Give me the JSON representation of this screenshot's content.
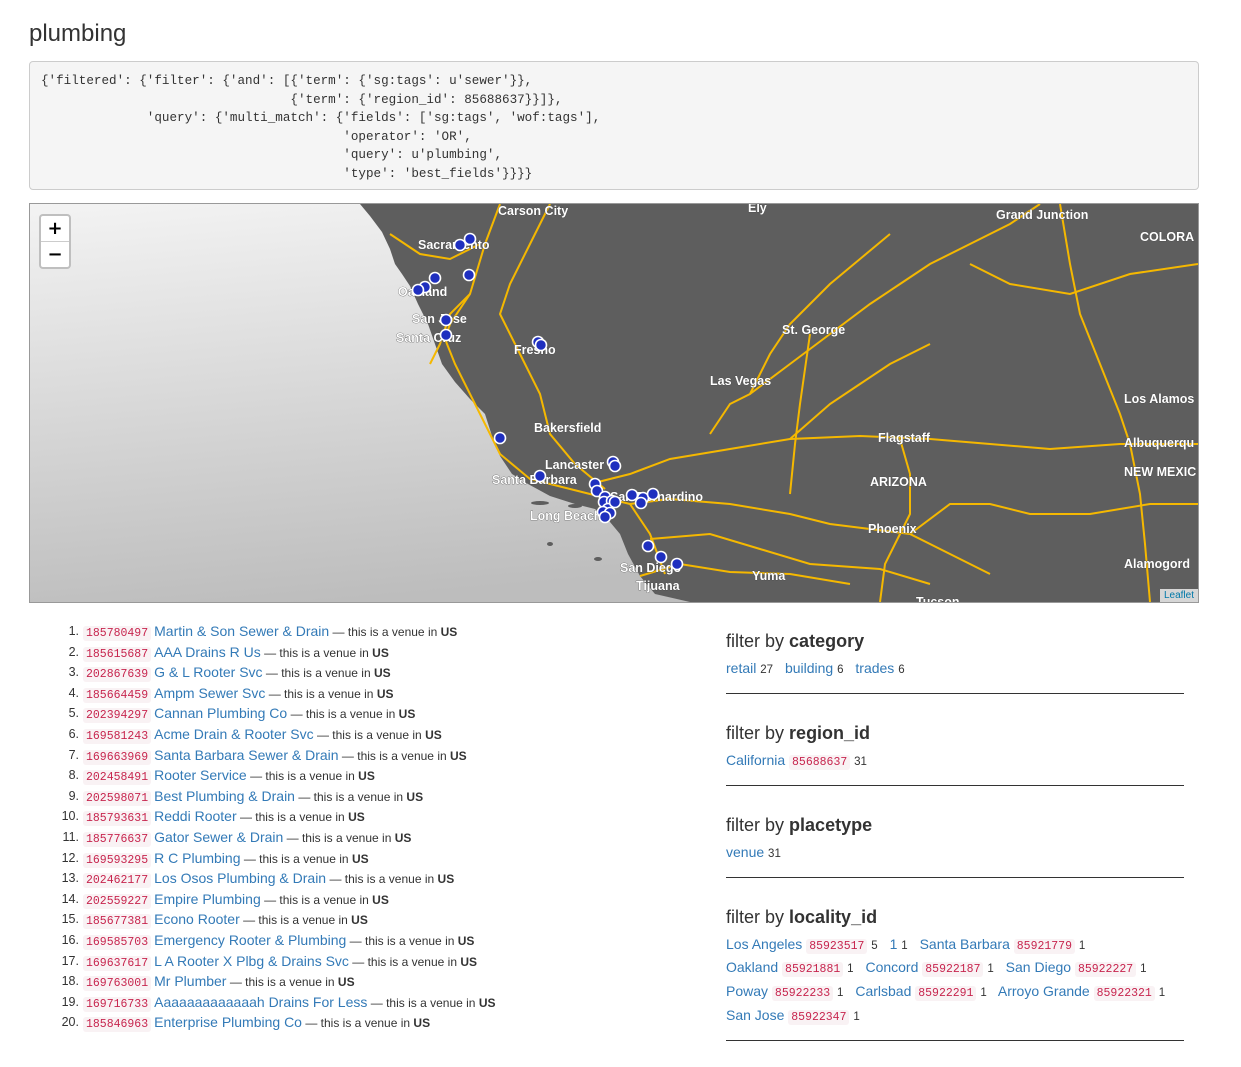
{
  "page": {
    "title": "plumbing"
  },
  "query": {
    "text": "{'filtered': {'filter': {'and': [{'term': {'sg:tags': u'sewer'}},\n                                 {'term': {'region_id': 85688637}}]},\n              'query': {'multi_match': {'fields': ['sg:tags', 'wof:tags'],\n                                        'operator': 'OR',\n                                        'query': u'plumbing',\n                                        'type': 'best_fields'}}}}"
  },
  "map": {
    "zoom_in": "+",
    "zoom_out": "−",
    "attribution": "Leaflet",
    "place_labels": [
      "Carson City",
      "Ely",
      "Grand Junction",
      "COLORA",
      "Sacramento",
      "Oakland",
      "San Jose",
      "Santa Cruz",
      "Fresno",
      "St. George",
      "Las Vegas",
      "Los Alamos",
      "Bakersfield",
      "Flagstaff",
      "Albuquerqu",
      "NEW MEXIC",
      "Lancaster",
      "Santa Barbara",
      "San Bernardino",
      "ARIZONA",
      "Long Beach",
      "Phoenix",
      "Alamogord",
      "San Diego",
      "Yuma",
      "Tijuana",
      "Tucson"
    ],
    "marker_count": 31
  },
  "results": [
    {
      "num": "1.",
      "id": "185780497",
      "name": "Martin & Son Sewer & Drain",
      "desc": "— this is a",
      "placetype": "venue",
      "in": "in",
      "country": "US"
    },
    {
      "num": "2.",
      "id": "185615687",
      "name": "AAA Drains R Us",
      "desc": "— this is a",
      "placetype": "venue",
      "in": "in",
      "country": "US"
    },
    {
      "num": "3.",
      "id": "202867639",
      "name": "G & L Rooter Svc",
      "desc": "— this is a",
      "placetype": "venue",
      "in": "in",
      "country": "US"
    },
    {
      "num": "4.",
      "id": "185664459",
      "name": "Ampm Sewer Svc",
      "desc": "— this is a",
      "placetype": "venue",
      "in": "in",
      "country": "US"
    },
    {
      "num": "5.",
      "id": "202394297",
      "name": "Cannan Plumbing Co",
      "desc": "— this is a",
      "placetype": "venue",
      "in": "in",
      "country": "US"
    },
    {
      "num": "6.",
      "id": "169581243",
      "name": "Acme Drain & Rooter Svc",
      "desc": "— this is a",
      "placetype": "venue",
      "in": "in",
      "country": "US"
    },
    {
      "num": "7.",
      "id": "169663969",
      "name": "Santa Barbara Sewer & Drain",
      "desc": "— this is a",
      "placetype": "venue",
      "in": "in",
      "country": "US"
    },
    {
      "num": "8.",
      "id": "202458491",
      "name": "Rooter Service",
      "desc": "— this is a",
      "placetype": "venue",
      "in": "in",
      "country": "US"
    },
    {
      "num": "9.",
      "id": "202598071",
      "name": "Best Plumbing & Drain",
      "desc": "— this is a",
      "placetype": "venue",
      "in": "in",
      "country": "US"
    },
    {
      "num": "10.",
      "id": "185793631",
      "name": "Reddi Rooter",
      "desc": "— this is a",
      "placetype": "venue",
      "in": "in",
      "country": "US"
    },
    {
      "num": "11.",
      "id": "185776637",
      "name": "Gator Sewer & Drain",
      "desc": "— this is a",
      "placetype": "venue",
      "in": "in",
      "country": "US"
    },
    {
      "num": "12.",
      "id": "169593295",
      "name": "R C Plumbing",
      "desc": "— this is a",
      "placetype": "venue",
      "in": "in",
      "country": "US"
    },
    {
      "num": "13.",
      "id": "202462177",
      "name": "Los Osos Plumbing & Drain",
      "desc": "— this is a",
      "placetype": "venue",
      "in": "in",
      "country": "US"
    },
    {
      "num": "14.",
      "id": "202559227",
      "name": "Empire Plumbing",
      "desc": "— this is a",
      "placetype": "venue",
      "in": "in",
      "country": "US"
    },
    {
      "num": "15.",
      "id": "185677381",
      "name": "Econo Rooter",
      "desc": "— this is a",
      "placetype": "venue",
      "in": "in",
      "country": "US"
    },
    {
      "num": "16.",
      "id": "169585703",
      "name": "Emergency Rooter & Plumbing",
      "desc": "— this is a",
      "placetype": "venue",
      "in": "in",
      "country": "US"
    },
    {
      "num": "17.",
      "id": "169637617",
      "name": "L A Rooter X Plbg & Drains Svc",
      "desc": "— this is a",
      "placetype": "venue",
      "in": "in",
      "country": "US"
    },
    {
      "num": "18.",
      "id": "169763001",
      "name": "Mr Plumber",
      "desc": "— this is a",
      "placetype": "venue",
      "in": "in",
      "country": "US"
    },
    {
      "num": "19.",
      "id": "169716733",
      "name": "Aaaaaaaaaaaaah Drains For Less",
      "desc": "— this is a",
      "placetype": "venue",
      "in": "in",
      "country": "US"
    },
    {
      "num": "20.",
      "id": "185846963",
      "name": "Enterprise Plumbing Co",
      "desc": "— this is a",
      "placetype": "venue",
      "in": "in",
      "country": "US"
    }
  ],
  "facets": {
    "category": {
      "prefix": "filter by",
      "name": "category",
      "items": [
        {
          "label": "retail",
          "count": "27"
        },
        {
          "label": "building",
          "count": "6"
        },
        {
          "label": "trades",
          "count": "6"
        }
      ]
    },
    "region": {
      "prefix": "filter by",
      "name": "region_id",
      "items": [
        {
          "label": "California",
          "id": "85688637",
          "count": "31"
        }
      ]
    },
    "placetype": {
      "prefix": "filter by",
      "name": "placetype",
      "items": [
        {
          "label": "venue",
          "count": "31"
        }
      ]
    },
    "locality": {
      "prefix": "filter by",
      "name": "locality_id",
      "items": [
        {
          "label": "Los Angeles",
          "id": "85923517",
          "count": "5"
        },
        {
          "label": "1",
          "id": "",
          "count": "1"
        },
        {
          "label": "Santa Barbara",
          "id": "85921779",
          "count": "1"
        },
        {
          "label": "Oakland",
          "id": "85921881",
          "count": "1"
        },
        {
          "label": "Concord",
          "id": "85922187",
          "count": "1"
        },
        {
          "label": "San Diego",
          "id": "85922227",
          "count": "1"
        },
        {
          "label": "Poway",
          "id": "85922233",
          "count": "1"
        },
        {
          "label": "Carlsbad",
          "id": "85922291",
          "count": "1"
        },
        {
          "label": "Arroyo Grande",
          "id": "85922321",
          "count": "1"
        },
        {
          "label": "San Jose",
          "id": "85922347",
          "count": "1"
        }
      ]
    }
  },
  "colors": {
    "link": "#337ab7",
    "code": "#c7254e",
    "marker": "#1f2fbf",
    "road": "#f5b800",
    "land": "#5e5e5e"
  }
}
